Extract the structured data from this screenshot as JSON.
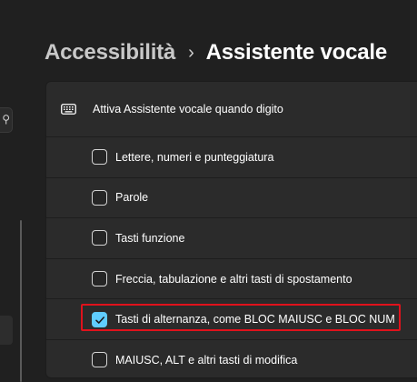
{
  "breadcrumb": {
    "parent": "Accessibilità",
    "separator": "›",
    "current": "Assistente vocale"
  },
  "card": {
    "header": {
      "icon": "keyboard-icon",
      "label": "Attiva Assistente vocale quando digito"
    },
    "options": [
      {
        "label": "Lettere, numeri e punteggiatura",
        "checked": false
      },
      {
        "label": "Parole",
        "checked": false
      },
      {
        "label": "Tasti funzione",
        "checked": false
      },
      {
        "label": "Freccia, tabulazione e altri tasti di spostamento",
        "checked": false
      },
      {
        "label": "Tasti di alternanza, come BLOC MAIUSC e BLOC NUM",
        "checked": true,
        "highlighted": true
      },
      {
        "label": "MAIUSC, ALT e altri tasti di modifica",
        "checked": false
      }
    ]
  },
  "colors": {
    "background": "#202020",
    "card": "#2b2b2b",
    "accent": "#60cdff",
    "highlight": "#e0121c"
  }
}
